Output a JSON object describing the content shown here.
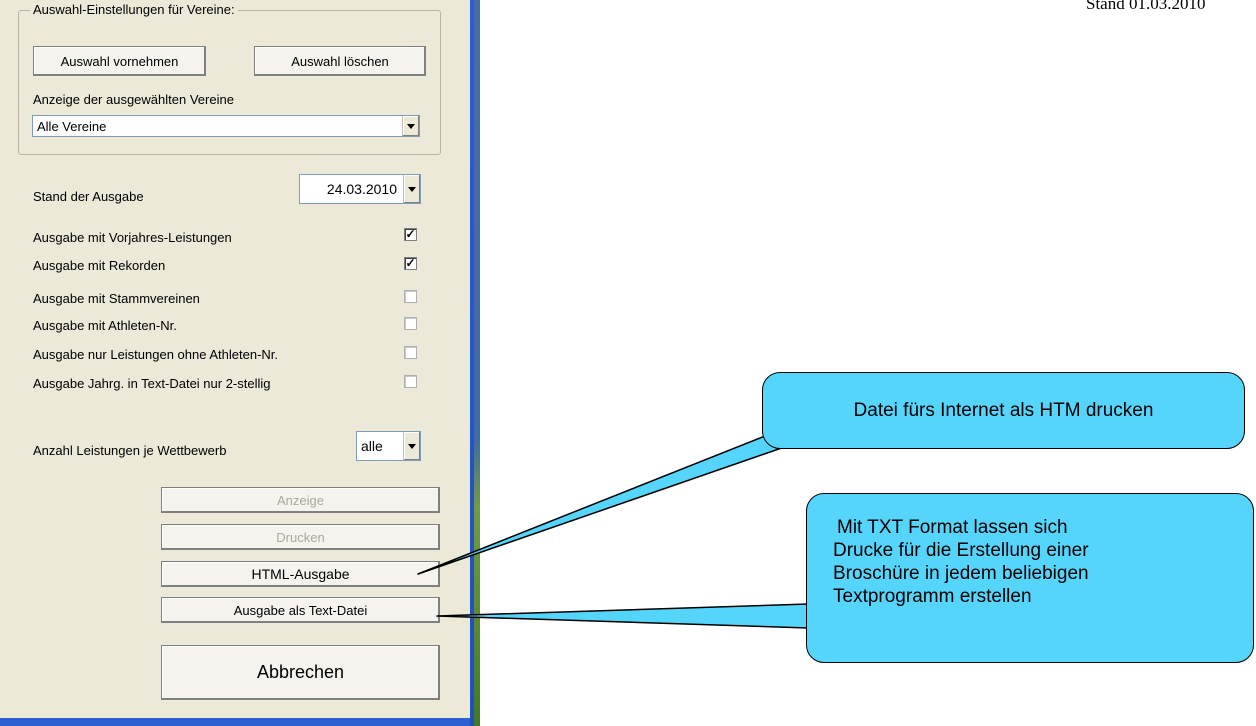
{
  "stand": "Stand 01.03.2010",
  "group": {
    "legend": "Auswahl-Einstellungen für Vereine:",
    "btn_select": "Auswahl vornehmen",
    "btn_clear": "Auswahl löschen",
    "display_label": "Anzeige der ausgewählten Vereine",
    "display_value": "Alle Vereine"
  },
  "stand_label": "Stand der Ausgabe",
  "stand_date": "24.03.2010",
  "options": [
    {
      "label": "Ausgabe mit Vorjahres-Leistungen",
      "checked": true
    },
    {
      "label": "Ausgabe mit Rekorden",
      "checked": true
    },
    {
      "label": "Ausgabe mit Stammvereinen",
      "checked": false
    },
    {
      "label": "Ausgabe mit Athleten-Nr.",
      "checked": false
    },
    {
      "label": "Ausgabe nur Leistungen ohne Athleten-Nr.",
      "checked": false
    },
    {
      "label": "Ausgabe Jahrg. in Text-Datei nur 2-stellig",
      "checked": false
    }
  ],
  "anzahl_label": "Anzahl Leistungen je Wettbewerb",
  "anzahl_value": "alle",
  "buttons": {
    "anzeige": "Anzeige",
    "drucken": "Drucken",
    "html": "HTML-Ausgabe",
    "text": "Ausgabe als Text-Datei",
    "abbrechen": "Abbrechen"
  },
  "callouts": {
    "htm": "Datei fürs Internet als HTM drucken",
    "txt_lines": [
      "Mit TXT Format lassen sich",
      "Drucke für die Erstellung einer",
      "Broschüre in jedem beliebigen",
      "Textprogramm erstellen"
    ]
  },
  "colors": {
    "callout": "#55d5fb",
    "dialog": "#ece9d8"
  }
}
